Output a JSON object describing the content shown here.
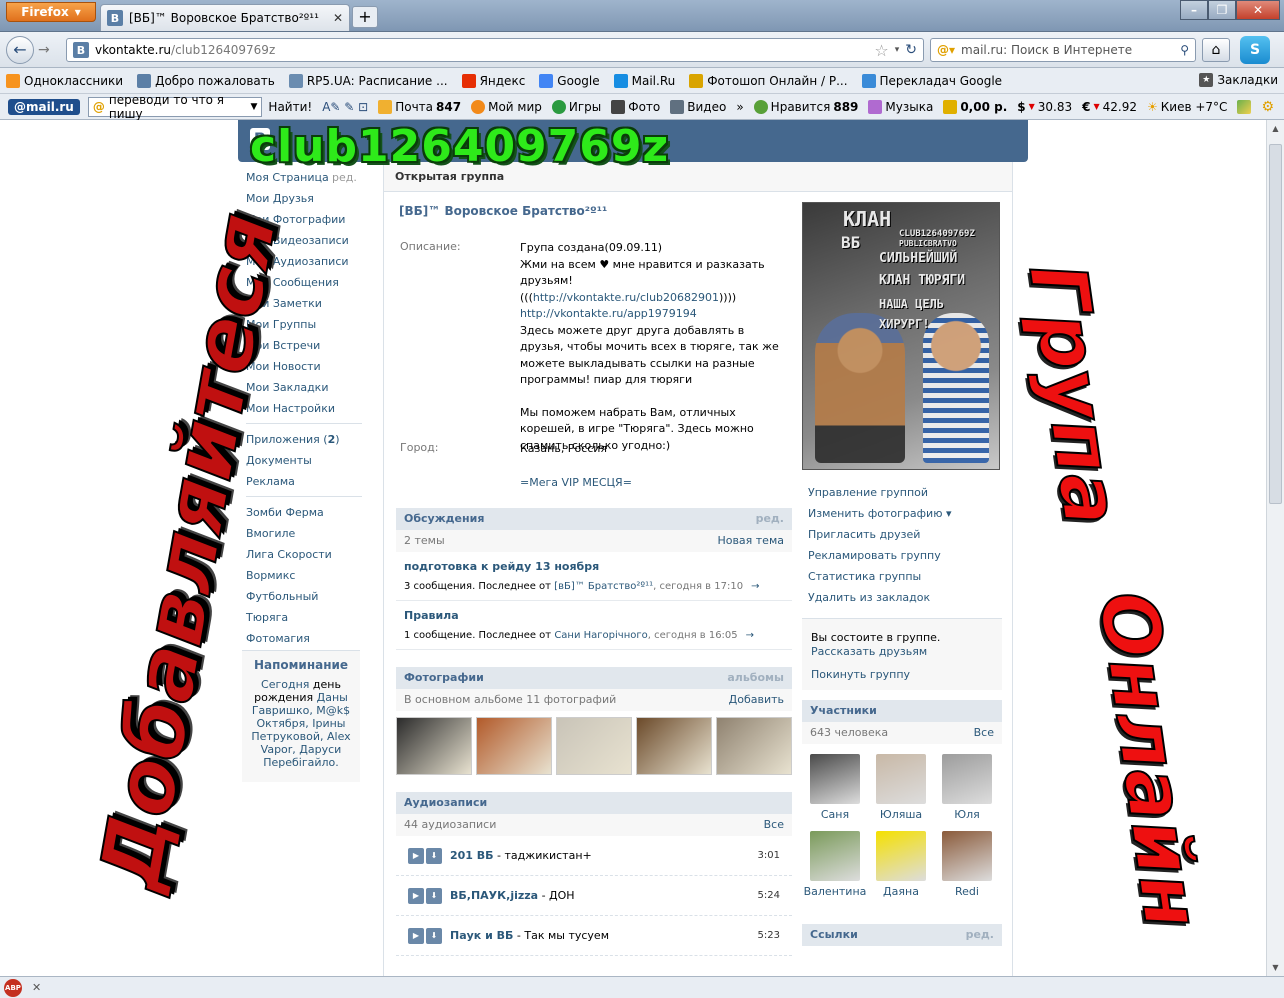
{
  "browser": {
    "app_button": "Firefox",
    "tab_title": "[ВБ]™ Воровское Братство²º¹¹",
    "tab_favicon": "В",
    "url_host": "vkontakte.ru",
    "url_path": "/club126409769z",
    "search_placeholder": "mail.ru: Поиск в Интернете",
    "bookmarks": [
      {
        "label": "Одноклассники",
        "icon": "ok-icon",
        "color": "#f7931e"
      },
      {
        "label": "Добро пожаловать",
        "icon": "vk-icon",
        "color": "#5b7fa6"
      },
      {
        "label": "RP5.UA: Расписание ...",
        "icon": "globe-icon",
        "color": "#6a8cb0"
      },
      {
        "label": "Яндекс",
        "icon": "yandex-icon",
        "color": "#e62e04"
      },
      {
        "label": "Google",
        "icon": "google-icon",
        "color": "#4285f4"
      },
      {
        "label": "Mail.Ru",
        "icon": "mailru-icon",
        "color": "#168de2"
      },
      {
        "label": "Фотошоп Онлайн / Р...",
        "icon": "photoshop-icon",
        "color": "#d9a400"
      },
      {
        "label": "Перекладач Google",
        "icon": "translate-icon",
        "color": "#3a8bd8"
      }
    ],
    "bookmarks_menu": "Закладки",
    "mailru_toolbar": {
      "logo": "@mail.ru",
      "search_value": "переводи то что я пишу",
      "search_button": "Найти!",
      "mail_label": "Почта",
      "mail_count": "847",
      "myworld": "Мой мир",
      "games": "Игры",
      "photo": "Фото",
      "video": "Видео",
      "more": "»",
      "likes_label": "Нравится",
      "likes_count": "889",
      "music": "Музыка",
      "money": "0,00 р.",
      "usd": "30.83",
      "eur": "42.92",
      "weather": "Киев +7°C"
    }
  },
  "vk": {
    "header_logo": "В",
    "left_nav": [
      "Моя Страница",
      "Мои Друзья",
      "Мои Фотографии",
      "Мои Видеозаписи",
      "Мои Аудиозаписи",
      "Мои Сообщения",
      "Мои Заметки",
      "Мои Группы",
      "Мои Встречи",
      "Мои Новости",
      "Мои Закладки",
      "Мои Настройки"
    ],
    "left_nav_edit": "ред.",
    "left_nav2": [
      "Документы",
      "Реклама"
    ],
    "apps_label": "Приложения (",
    "apps_count": "2",
    "apps_close": ")",
    "left_apps": [
      "Зомби Ферма",
      "Вмогиле",
      "Лига Скорости",
      "Вормикс",
      "Футбольный",
      "Тюряга",
      "Фотомагия"
    ],
    "reminder": {
      "title": "Напоминание",
      "today": "Сегодня",
      "dr": "день рождения",
      "names": "Даны Гавришко, M@k$ Октября, Ірины Петруковой, Alex Vapor, Даруси Перебігайло."
    },
    "group_type": "Открытая группа",
    "group_name": "[ВБ]™ Воровское Братство²º¹¹",
    "desc_label": "Описание:",
    "desc_line1": "Група создана(09.09.11)",
    "desc_line2": "Жми на всем ♥ мне нравится и разказать друзьям!",
    "desc_link1_pre": "(((",
    "desc_link1": "http://vkontakte.ru/club20682901",
    "desc_link1_post": "))))",
    "desc_link2": "http://vkontakte.ru/app1979194",
    "desc_p2": "Здесь можете друг друга добавлять в друзья, чтобы мочить всех в тюряге, так же можете выкладывать ссылки на разные программы! пиар для тюряги",
    "desc_p3": "Мы поможем набрать Вам, отличных корешей, в игре \"Тюряга\". Здесь можно спамить сколько угодно:)",
    "city_label": "Город:",
    "city_value": "Казань, Россия",
    "vip_link": "=Мега VIP МЕСЦЯ=",
    "discussions": {
      "title": "Обсуждения",
      "edit": "ред.",
      "count": "2 темы",
      "new_topic": "Новая тема",
      "topics": [
        {
          "title": "подготовка к рейду 13 ноября",
          "meta": "3 сообщения. Последнее от ",
          "author": "[вБ]™ Братство²º¹¹",
          "time": ", сегодня в 17:10",
          "arrow": "→"
        },
        {
          "title": "Правила",
          "meta": "1 сообщение. Последнее от ",
          "author": "Сани Нагорічного",
          "time": ", сегодня в 16:05",
          "arrow": "→"
        }
      ]
    },
    "photos": {
      "title": "Фотографии",
      "albums": "альбомы",
      "count": "В основном альбоме 11 фотографий",
      "add": "Добавить",
      "thumbs": [
        "#2b2b2b",
        "#b25a2a",
        "#c9c4b8",
        "#6b4a2a",
        "#8f8270"
      ]
    },
    "audio": {
      "title": "Аудиозаписи",
      "count": "44 аудиозаписи",
      "all": "Все",
      "tracks": [
        {
          "artist": "201 ВБ",
          "title": " - таджикистан+",
          "duration": "3:01"
        },
        {
          "artist": "ВБ,ПАУК,jizza",
          "title": " - ДОН",
          "duration": "5:24"
        },
        {
          "artist": "Паук и ВБ",
          "title": " - Так мы тусуем",
          "duration": "5:23"
        }
      ]
    },
    "avatar_text": [
      "КЛАН",
      "ВБ",
      "CLUB126409769Z",
      "PUBLICBRATVO",
      "СИЛЬНЕЙШИЙ",
      "КЛАН ТЮРЯГИ",
      "НАША ЦЕЛЬ",
      "ХИРУРГ!"
    ],
    "admin_links": [
      "Управление группой",
      "Изменить фотографию ▾",
      "Пригласить друзей",
      "Рекламировать группу",
      "Статистика группы",
      "Удалить из закладок"
    ],
    "member": {
      "status": "Вы состоите в группе.",
      "tell": "Рассказать друзьям",
      "leave": "Покинуть группу"
    },
    "members": {
      "title": "Участники",
      "count": "643 человека",
      "all": "Все",
      "people": [
        {
          "name": "Саня",
          "color": "#4a4a4a"
        },
        {
          "name": "Юляша",
          "color": "#c8b8a6"
        },
        {
          "name": "Юля",
          "color": "#9c9c9c"
        },
        {
          "name": "Валентина",
          "color": "#7a9a5a"
        },
        {
          "name": "Даяна",
          "color": "#f5e000"
        },
        {
          "name": "Redi",
          "color": "#8a5a3a"
        }
      ]
    },
    "links_block": {
      "title": "Ссылки",
      "edit": "ред."
    }
  },
  "overlay": {
    "title": "club126409769z",
    "left": "Добавляйтеся",
    "right1": "Група",
    "right2": "Онлайн"
  }
}
